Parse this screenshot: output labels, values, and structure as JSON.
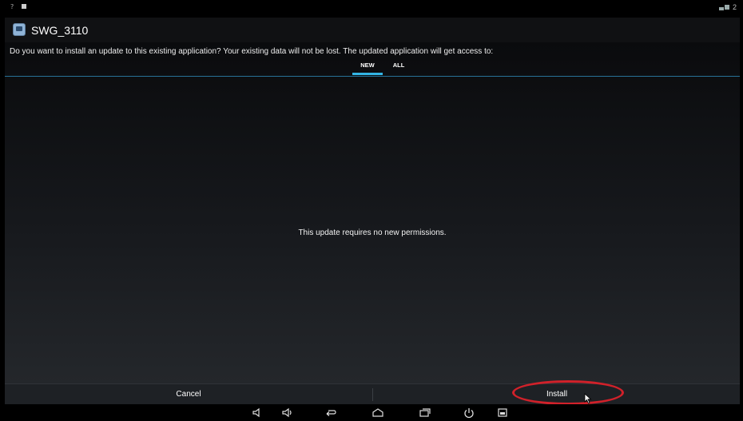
{
  "status_bar": {
    "left_icons": [
      "question-icon",
      "notification-square-icon"
    ],
    "right_icons": [
      "network-icon"
    ],
    "time_fragment": "2"
  },
  "dialog": {
    "app_title": "SWG_3110",
    "app_icon": "app-icon",
    "prompt": "Do you want to install an update to this existing application? Your existing data will not be lost. The updated application will get access to:",
    "tabs": [
      {
        "label": "NEW",
        "selected": true
      },
      {
        "label": "ALL",
        "selected": false
      }
    ],
    "message": "This update requires no new permissions.",
    "buttons": {
      "cancel": "Cancel",
      "install": "Install"
    }
  },
  "annotation": {
    "highlight_color": "#d1212a",
    "target": "Install"
  },
  "nav_bar": {
    "icons": [
      "volume-down-icon",
      "volume-up-icon",
      "back-icon",
      "home-icon",
      "recent-apps-icon",
      "power-icon",
      "screenshot-icon"
    ]
  },
  "colors": {
    "accent": "#33b5e5",
    "background": "#000000"
  }
}
